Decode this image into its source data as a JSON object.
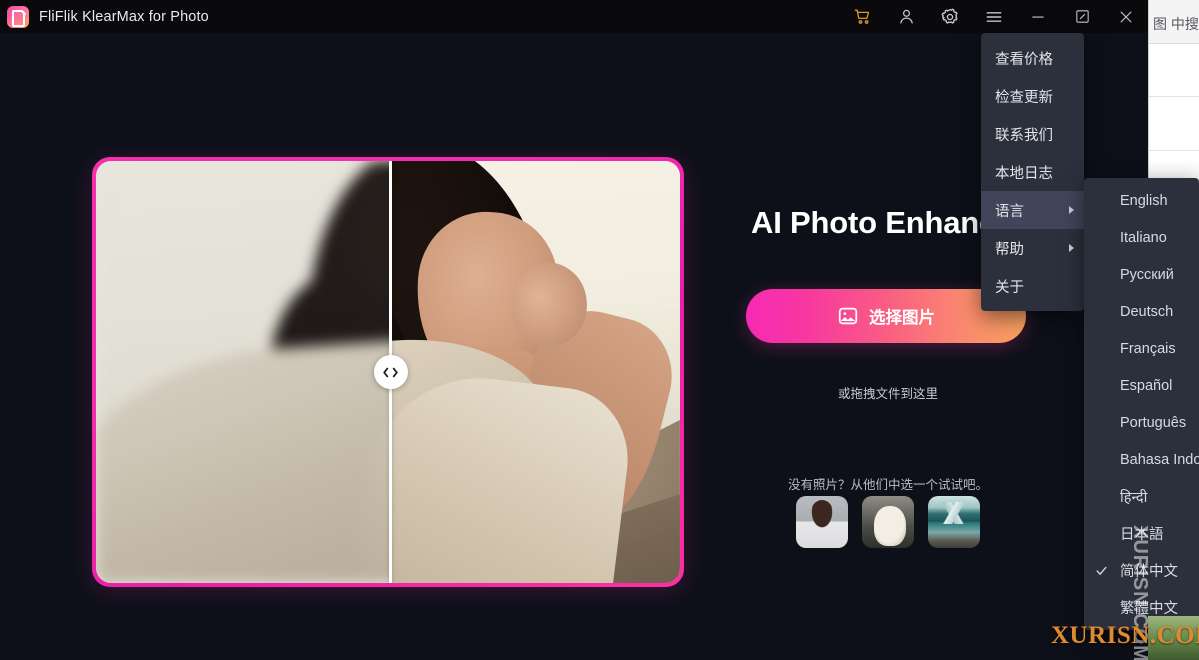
{
  "window": {
    "title": "FliFlik KlearMax for Photo",
    "app_icon": "app-logo-icon"
  },
  "titlebar": {
    "buttons": [
      {
        "name": "cart-icon",
        "label": "购物车",
        "color": "#d8962f"
      },
      {
        "name": "account-icon",
        "label": "账户",
        "color": "#c8cad2"
      },
      {
        "name": "settings-gear-icon",
        "label": "设置",
        "color": "#c8cad2"
      },
      {
        "name": "hamburger-menu-icon",
        "label": "菜单",
        "color": "#c8cad2"
      },
      {
        "name": "minimize-icon",
        "label": "最小化",
        "color": "#c8cad2"
      },
      {
        "name": "maximize-icon",
        "label": "最大化",
        "color": "#c8cad2"
      },
      {
        "name": "close-icon",
        "label": "关闭",
        "color": "#c8cad2"
      }
    ]
  },
  "menu": {
    "items": [
      {
        "label": "查看价格",
        "has_submenu": false,
        "highlighted": false
      },
      {
        "label": "检查更新",
        "has_submenu": false,
        "highlighted": false
      },
      {
        "label": "联系我们",
        "has_submenu": false,
        "highlighted": false
      },
      {
        "label": "本地日志",
        "has_submenu": false,
        "highlighted": false
      },
      {
        "label": "语言",
        "has_submenu": true,
        "highlighted": true
      },
      {
        "label": "帮助",
        "has_submenu": true,
        "highlighted": false
      },
      {
        "label": "关于",
        "has_submenu": false,
        "highlighted": false
      }
    ]
  },
  "language_submenu": {
    "items": [
      {
        "label": "English",
        "selected": false
      },
      {
        "label": "Italiano",
        "selected": false
      },
      {
        "label": "Русский",
        "selected": false
      },
      {
        "label": "Deutsch",
        "selected": false
      },
      {
        "label": "Français",
        "selected": false
      },
      {
        "label": "Español",
        "selected": false
      },
      {
        "label": "Português",
        "selected": false
      },
      {
        "label": "Bahasa Indonesia",
        "selected": false
      },
      {
        "label": "हिन्दी",
        "selected": false
      },
      {
        "label": "日本語",
        "selected": false
      },
      {
        "label": "简体中文",
        "selected": true
      },
      {
        "label": "繁體中文",
        "selected": false
      }
    ]
  },
  "preview": {
    "before_after_slider_position": "50%",
    "handle_icon": "left-right-arrows-icon",
    "border_color": "#f52fae"
  },
  "main": {
    "headline": "AI Photo Enhancer",
    "choose_button": {
      "label": "选择图片",
      "icon": "image-picker-icon",
      "gradient_from": "#f72ab4",
      "gradient_to": "#fba25f"
    },
    "drag_hint": "或拖拽文件到这里",
    "samples_label": "没有照片？从他们中选一个试试吧。",
    "samples": [
      {
        "name": "sample-portrait",
        "alt": "portrait"
      },
      {
        "name": "sample-cat",
        "alt": "cat"
      },
      {
        "name": "sample-landscape",
        "alt": "landscape"
      }
    ]
  },
  "background_window": {
    "text": "图 中搜索"
  },
  "watermark": {
    "main": "XURISN.COM",
    "vertical": "XURISN.COM",
    "color": "#e08a2e"
  }
}
